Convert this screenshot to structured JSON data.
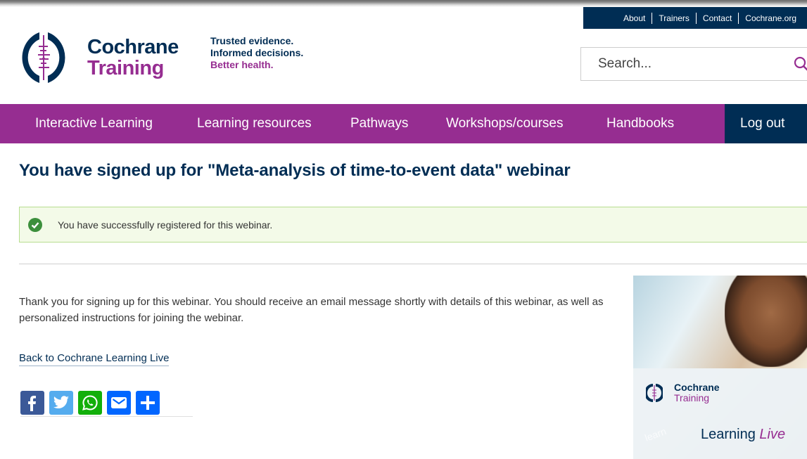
{
  "utility_nav": [
    "About",
    "Trainers",
    "Contact",
    "Cochrane.org"
  ],
  "logo": {
    "line1": "Cochrane",
    "line2": "Training"
  },
  "tagline": [
    "Trusted evidence.",
    "Informed decisions.",
    "Better health."
  ],
  "search": {
    "placeholder": "Search..."
  },
  "main_nav": [
    "Interactive Learning",
    "Learning resources",
    "Pathways",
    "Workshops/courses",
    "Handbooks"
  ],
  "logout_label": "Log out",
  "page_title": "You have signed up for \"Meta-analysis of time-to-event data\" webinar",
  "alert": {
    "message": "You have successfully registered for this webinar."
  },
  "body_text": "Thank you for signing up for this webinar. You should receive an email message shortly with details of this webinar, as well as personalized instructions for joining the webinar.",
  "back_link": "Back to Cochrane Learning Live",
  "share_icons": [
    "facebook-icon",
    "twitter-icon",
    "whatsapp-icon",
    "email-icon",
    "share-plus-icon"
  ],
  "promo": {
    "logo_line1": "Cochrane",
    "logo_line2": "Training",
    "learning": "Learning",
    "live": "Live",
    "learn_word": "learn"
  },
  "colors": {
    "navy": "#002d54",
    "purple": "#962d91",
    "alert_bg": "#f3fae8",
    "alert_border": "#b7de8f",
    "success": "#5cb85c"
  }
}
